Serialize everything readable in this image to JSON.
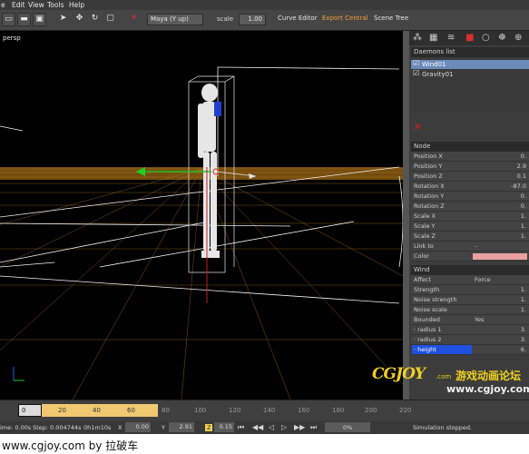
{
  "menu": [
    "e",
    "Edit",
    "View",
    "Tools",
    "Help"
  ],
  "toolbar": {
    "camera_mode": "Maya (Y up)",
    "scale_label": "scale",
    "scale_value": "1.00",
    "tabs": [
      {
        "label": "Curve Editor",
        "active": false
      },
      {
        "label": "Export Central",
        "active": true
      },
      {
        "label": "Scene Tree",
        "active": false
      }
    ]
  },
  "viewport": {
    "label": "persp",
    "background": "#000000",
    "ground_color": "#c8861e"
  },
  "panel": {
    "daemons_header": "Daemons list",
    "daemons": [
      {
        "label": "Wind01",
        "checked": true,
        "selected": true
      },
      {
        "label": "Gravity01",
        "checked": true,
        "selected": false
      }
    ],
    "node_header": "Node",
    "node_rows": [
      {
        "label": "Position X",
        "value": "0."
      },
      {
        "label": "Position Y",
        "value": "2.9"
      },
      {
        "label": "Position Z",
        "value": "0.1"
      },
      {
        "label": "Rotation X",
        "value": "-87.0"
      },
      {
        "label": "Rotation Y",
        "value": "0."
      },
      {
        "label": "Rotation Z",
        "value": "0."
      },
      {
        "label": "Scale X",
        "value": "1."
      },
      {
        "label": "Scale Y",
        "value": "1."
      },
      {
        "label": "Scale Z",
        "value": "1."
      },
      {
        "label": "Link to",
        "value": "-"
      },
      {
        "label": "Color",
        "value": ""
      }
    ],
    "wind_header": "Wind",
    "wind_rows": [
      {
        "label": "Affect",
        "mid": "Force",
        "value": ""
      },
      {
        "label": "Strength",
        "mid": "",
        "value": "1."
      },
      {
        "label": "Noise strength",
        "mid": "",
        "value": "1."
      },
      {
        "label": "Noise scale",
        "mid": "",
        "value": "1."
      },
      {
        "label": "Bounded",
        "mid": "Yes",
        "value": ""
      },
      {
        "label": "· radius 1",
        "mid": "",
        "value": "3."
      },
      {
        "label": "· radius 2",
        "mid": "",
        "value": "3."
      },
      {
        "label": "· height",
        "mid": "",
        "value": "6."
      }
    ],
    "color_swatch": "#e8a0a0"
  },
  "timeline": {
    "current_frame": "0",
    "ticks": [
      "20",
      "40",
      "60",
      "80",
      "100",
      "120",
      "140",
      "160",
      "180",
      "200",
      "220"
    ],
    "range_color": "#f0c870"
  },
  "status": {
    "time": "ime: 0.00s",
    "step": "Step: 0.004744s",
    "elapsed": "0h1m10s",
    "x_label": "X",
    "x_value": "0.00",
    "y_label": "Y",
    "y_value": "2.91",
    "z_label": "Z",
    "z_value": "0.15",
    "progress": "0%",
    "message": "Simulation stopped."
  },
  "watermark": {
    "logo": "CGJOY",
    "logo_suffix": ".com",
    "chinese": "游戏动画论坛",
    "url": "www.cgjoy.com"
  },
  "footer": "www.cgjoy.com by 拉破车"
}
